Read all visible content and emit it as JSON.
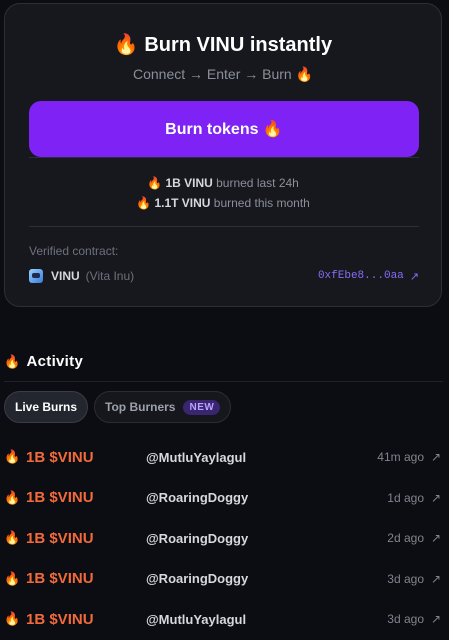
{
  "card": {
    "title": "🔥 Burn VINU instantly",
    "subtitle": "Connect → Enter → Burn 🔥",
    "burn_button_label": "Burn tokens 🔥",
    "stats": [
      {
        "icon": "🔥",
        "amount": "1B VINU",
        "text": " burned last 24h"
      },
      {
        "icon": "🔥",
        "amount": "1.1T VINU",
        "text": " burned this month"
      }
    ],
    "verified_label": "Verified contract:",
    "token_symbol": "VINU",
    "token_name": "(Vita Inu)",
    "contract_address": "0xfEbe8...0aa",
    "external_link_icon": "↗"
  },
  "activity": {
    "icon": "🔥",
    "title": "Activity",
    "tabs": [
      {
        "label": "Live Burns",
        "active": true
      },
      {
        "label": "Top Burners",
        "active": false,
        "badge": "NEW"
      }
    ],
    "rows": [
      {
        "icon": "🔥",
        "amount": "1B $VINU",
        "user": "@MutluYaylagul",
        "time": "41m ago",
        "link_icon": "↗"
      },
      {
        "icon": "🔥",
        "amount": "1B $VINU",
        "user": "@RoaringDoggy",
        "time": "1d ago",
        "link_icon": "↗"
      },
      {
        "icon": "🔥",
        "amount": "1B $VINU",
        "user": "@RoaringDoggy",
        "time": "2d ago",
        "link_icon": "↗"
      },
      {
        "icon": "🔥",
        "amount": "1B $VINU",
        "user": "@RoaringDoggy",
        "time": "3d ago",
        "link_icon": "↗"
      },
      {
        "icon": "🔥",
        "amount": "1B $VINU",
        "user": "@MutluYaylagul",
        "time": "3d ago",
        "link_icon": "↗"
      }
    ]
  },
  "colors": {
    "accent": "#7e22f5",
    "amount": "#f26a3c",
    "address": "#8b6cf7",
    "background": "#0b0d12"
  }
}
